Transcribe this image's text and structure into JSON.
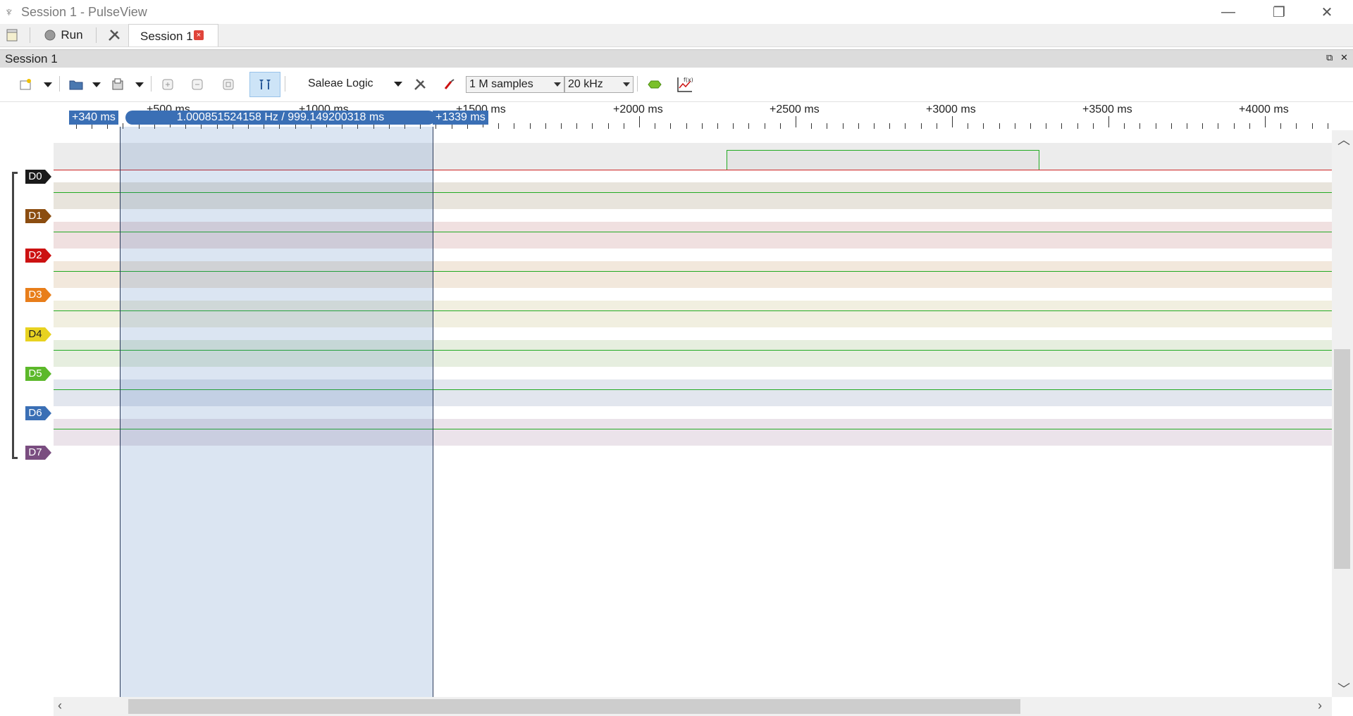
{
  "window": {
    "title": "Session 1 - PulseView",
    "minimize_glyph": "—",
    "restore_glyph": "❐",
    "close_glyph": "✕"
  },
  "main_toolbar": {
    "run_label": "Run",
    "tab_label": "Session 1",
    "tab_close_glyph": "×"
  },
  "dock": {
    "title": "Session 1",
    "float_glyph": "⧉",
    "close_glyph": "✕"
  },
  "session_toolbar": {
    "device": "Saleae Logic",
    "samples": "1 M samples",
    "rate": "20 kHz"
  },
  "ruler": {
    "ticks": [
      "+500 ms",
      "+1000 ms",
      "+1500 ms",
      "+2000 ms",
      "+2500 ms",
      "+3000 ms",
      "+3500 ms",
      "+4000 ms"
    ],
    "cursor_left": "+340 ms",
    "cursor_right": "+1339 ms",
    "cursor_measure": "1.000851524158 Hz / 999.149200318 ms"
  },
  "channels": [
    {
      "name": "D0",
      "color": "#1a1a1a",
      "row_bg": "#ececec",
      "pulse": [
        2280,
        3280
      ]
    },
    {
      "name": "D1",
      "color": "#8b4d10",
      "row_bg": "#e8e4dc"
    },
    {
      "name": "D2",
      "color": "#cc1111",
      "row_bg": "#f0e0e0"
    },
    {
      "name": "D3",
      "color": "#e87e1a",
      "row_bg": "#f2e8dc"
    },
    {
      "name": "D4",
      "color": "#e8d220",
      "row_bg": "#f1efe0"
    },
    {
      "name": "D5",
      "color": "#5cb82a",
      "row_bg": "#e6eedf"
    },
    {
      "name": "D6",
      "color": "#3a6fb5",
      "row_bg": "#e2e6ee"
    },
    {
      "name": "D7",
      "color": "#7a4d80",
      "row_bg": "#ebe3ea"
    }
  ]
}
